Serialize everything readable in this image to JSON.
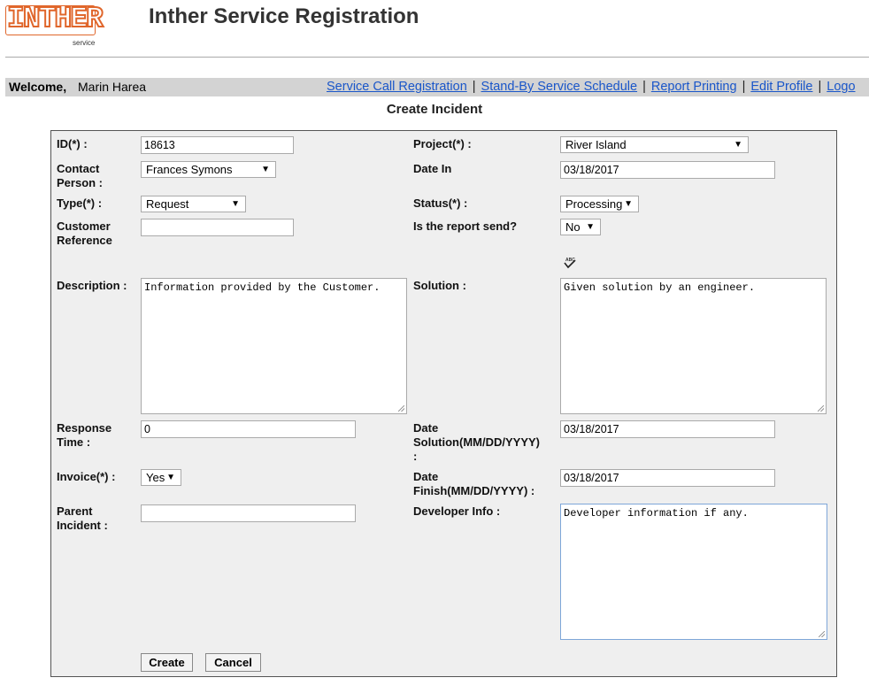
{
  "header": {
    "logo_text": "INTHER",
    "logo_sub": "service",
    "title": "Inther Service Registration"
  },
  "welcome": {
    "label": "Welcome,",
    "user": "Marin Harea"
  },
  "nav": {
    "items": [
      "Service Call Registration",
      "Stand-By Service Schedule",
      "Report Printing",
      "Edit Profile",
      "Logo"
    ],
    "separator": "|",
    "link_color": "#1a56c9"
  },
  "page_title": "Create Incident",
  "form": {
    "id": {
      "label": "ID(*) :",
      "value": "18613"
    },
    "project": {
      "label": "Project(*) :",
      "value": "River Island"
    },
    "contact": {
      "label_line1": "Contact",
      "label_line2": "Person :",
      "value": "Frances Symons"
    },
    "date_in": {
      "label": "Date In",
      "value": "03/18/2017"
    },
    "type": {
      "label": "Type(*) :",
      "value": "Request"
    },
    "status": {
      "label": "Status(*) :",
      "value": "Processing"
    },
    "customer_reference": {
      "label_line1": "Customer",
      "label_line2": "Reference",
      "value": ""
    },
    "report_send": {
      "label": "Is the report send?",
      "value": "No"
    },
    "spellcheck_icon": "abc-spellcheck-icon",
    "description": {
      "label": "Description :",
      "value": "Information provided by the Customer."
    },
    "solution": {
      "label": "Solution :",
      "value": "Given solution by an engineer."
    },
    "response_time": {
      "label_line1": "Response",
      "label_line2": "Time :",
      "value": "0"
    },
    "date_solution": {
      "label_line1": "Date",
      "label_line2": "Solution(MM/DD/YYYY)",
      "label_line3": ":",
      "value": "03/18/2017"
    },
    "invoice": {
      "label": "Invoice(*) :",
      "value": "Yes"
    },
    "date_finish": {
      "label_line1": "Date",
      "label_line2": "Finish(MM/DD/YYYY) :",
      "value": "03/18/2017"
    },
    "parent_incident": {
      "label_line1": "Parent",
      "label_line2": "Incident :",
      "value": ""
    },
    "developer_info": {
      "label": "Developer Info :",
      "value": "Developer information if any."
    },
    "buttons": {
      "create": "Create",
      "cancel": "Cancel"
    }
  }
}
